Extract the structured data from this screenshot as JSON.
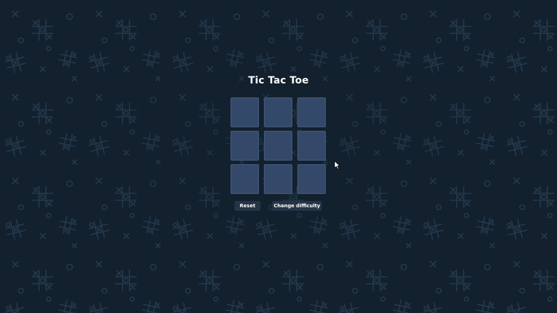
{
  "game": {
    "title": "Tic Tac Toe",
    "board": [
      "",
      "",
      "",
      "",
      "",
      "",
      "",
      "",
      ""
    ]
  },
  "controls": {
    "reset_label": "Reset",
    "difficulty_label": "Change difficulty"
  },
  "theme": {
    "background": "#13202d",
    "pattern_color": "#233a4d",
    "cell_color": "#34496a",
    "button_color": "#263546",
    "text_color": "#ffffff"
  },
  "icons": {
    "pointer": "mouse-pointer-icon"
  }
}
